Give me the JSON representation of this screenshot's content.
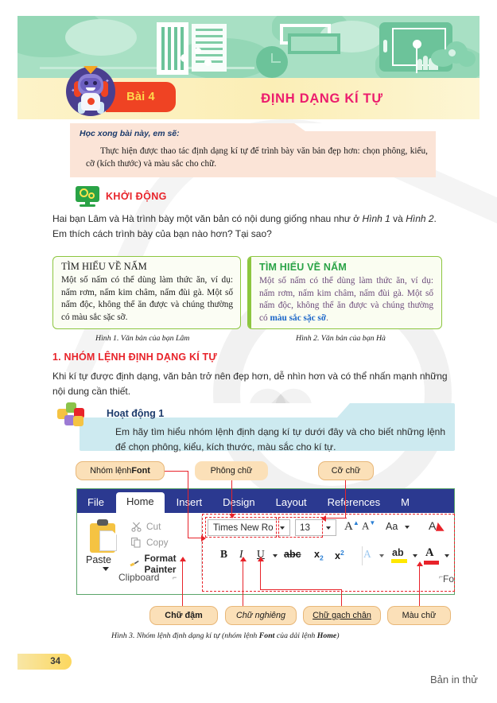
{
  "banner": {
    "icons": [
      "book-icon",
      "document-icon",
      "clock-icon",
      "tablet-icon",
      "cloud-icon",
      "molecule-icon",
      "filmstrip-icon"
    ]
  },
  "header": {
    "lesson_tag": "Bài 4",
    "title": "ĐỊNH DẠNG KÍ TỰ",
    "tag_color": "#ef4323",
    "tag_text_color": "#ffd84d",
    "title_color": "#ec1c6d",
    "mascot": "robot-mascot-icon"
  },
  "objectives": {
    "heading": "Học xong bài này, em sẽ:",
    "text": "Thực hiện được thao tác định dạng kí tự để trình bày văn bản đẹp hơn: chọn phông, kiểu, cỡ (kích thước) và màu sắc cho chữ.",
    "bg_color": "#fbe4d7",
    "heading_color": "#1b3a6b"
  },
  "warmup": {
    "icon": "monitor-gears-icon",
    "title": "KHỞI ĐỘNG",
    "title_color": "#e8232a",
    "text_part1": "Hai bạn Lâm và Hà trình bày một văn bản có nội dung giống nhau như ở ",
    "ref1": "Hình 1",
    "text_part2": " và ",
    "ref2": "Hình 2",
    "text_part3": ". Em thích cách trình bày của bạn nào hơn? Tại sao?"
  },
  "compare": {
    "left": {
      "heading": "TÌM HIỂU VỀ NẤM",
      "body": "Một số nấm có thể dùng làm thức ăn, ví dụ: nấm rơm, nấm kim châm, nấm đùi gà. Một số nấm độc, không thể ăn được và chúng thường có màu sắc sặc sỡ.",
      "caption": "Hình 1. Văn bản của bạn Lâm",
      "border_color": "#8cc63f"
    },
    "right": {
      "heading": "TÌM HIỂU VỀ NẤM",
      "heading_color": "#2aa346",
      "body_prefix": "Một số nấm có thể dùng làm thức ăn, ví dụ: nấm rơm, nấm kim châm, nấm đùi gà. Một số nấm độc, không thể ăn được và chúng thường có ",
      "body_highlight": "màu sắc sặc sỡ",
      "body_suffix": ".",
      "highlight_color": "#1b66c9",
      "body_color": "#6b4a7a",
      "caption": "Hình 2. Văn bản của bạn Hà",
      "border_color": "#8cc63f"
    }
  },
  "section1": {
    "heading": "1. NHÓM LỆNH ĐỊNH DẠNG KÍ TỰ",
    "heading_color": "#e8232a",
    "paragraph": "Khi kí tự được định dạng, văn bản trở nên đẹp hơn, dễ nhìn hơn và có thể nhấn mạnh những nội dung cần thiết."
  },
  "activity": {
    "icon": "puzzle-pieces-icon",
    "title": "Hoạt động 1",
    "title_color": "#1b3a6b",
    "text": "Em hãy tìm hiểu nhóm lệnh định dạng kí tự dưới đây và cho biết những lệnh để chọn phông, kiểu, kích thước, màu sắc cho kí tự.",
    "bg_color": "#cdeaf0"
  },
  "callouts": {
    "top": [
      {
        "name": "font-group-callout",
        "prefix": "Nhóm lệnh ",
        "bold": "Font"
      },
      {
        "name": "font-name-callout",
        "text": "Phông chữ"
      },
      {
        "name": "font-size-callout",
        "text": "Cỡ chữ"
      }
    ],
    "bottom": [
      {
        "name": "bold-callout",
        "text": "Chữ đậm",
        "style": "bold"
      },
      {
        "name": "italic-callout",
        "text": "Chữ nghiêng",
        "style": "italic"
      },
      {
        "name": "underline-callout",
        "text": "Chữ gạch chân",
        "style": "underline"
      },
      {
        "name": "font-color-callout",
        "text": "Màu chữ",
        "style": "normal"
      }
    ],
    "bg_color": "#fbe0b8",
    "line_color": "#e8232a"
  },
  "ribbon": {
    "tabs": [
      {
        "label": "File",
        "active": false
      },
      {
        "label": "Home",
        "active": true
      },
      {
        "label": "Insert",
        "active": false
      },
      {
        "label": "Design",
        "active": false
      },
      {
        "label": "Layout",
        "active": false
      },
      {
        "label": "References",
        "active": false
      },
      {
        "label": "M",
        "active": false
      }
    ],
    "tab_bar_color": "#2b3990",
    "clipboard": {
      "paste_label": "Paste",
      "cut_label": "Cut",
      "copy_label": "Copy",
      "format_painter_label": "Format Painter",
      "group_label": "Clipboard",
      "dialog_launcher": "⌐",
      "icons": [
        "clipboard-icon",
        "scissors-icon",
        "copy-icon",
        "paintbrush-icon"
      ]
    },
    "font": {
      "font_name_value": "Times New Ro",
      "font_size_value": "13",
      "grow_font": "A",
      "shrink_font": "A",
      "change_case": "Aa",
      "clear_formatting": "A",
      "bold": "B",
      "italic": "I",
      "underline": "U",
      "strikethrough": "abc",
      "subscript": "x",
      "subscript_index": "2",
      "superscript": "x",
      "superscript_index": "2",
      "text_effects": "A",
      "highlight": "ab",
      "font_color": "A",
      "highlight_color": "#ffe800",
      "font_color_swatch": "#e8232a",
      "group_label": "Font",
      "dialog_launcher": "⌐"
    }
  },
  "figure3": {
    "caption_prefix": "Hình 3. Nhóm lệnh định dạng kí tự (nhóm lệnh ",
    "caption_bold1": "Font",
    "caption_mid": " của dải lệnh ",
    "caption_bold2": "Home",
    "caption_suffix": ")"
  },
  "footer": {
    "page_number": "34",
    "trial_mark": "Bản in thử"
  }
}
